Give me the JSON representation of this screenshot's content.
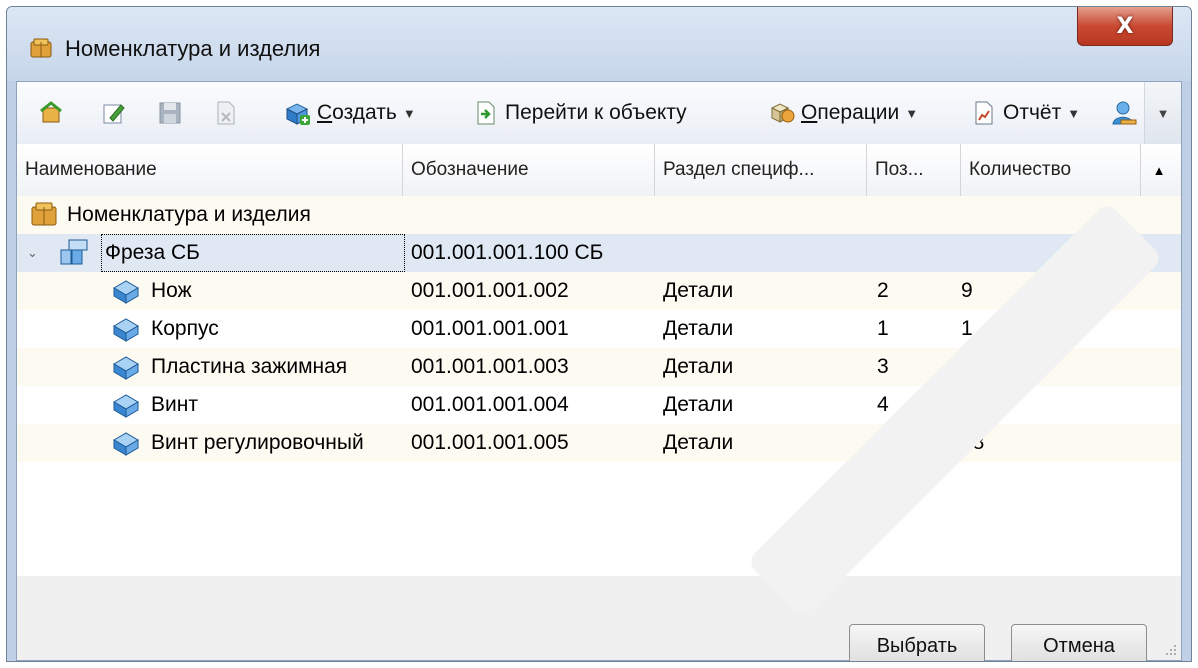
{
  "window": {
    "title": "Номенклатура и изделия",
    "close_label": "X"
  },
  "toolbar": {
    "create_accel": "С",
    "create_rest": "оздать",
    "goto_label": "Перейти к объекту",
    "ops_accel": "О",
    "ops_rest": "перации",
    "report_label": "Отчёт"
  },
  "grid": {
    "columns": [
      "Наименование",
      "Обозначение",
      "Раздел специф...",
      "Поз...",
      "Количество"
    ],
    "root": {
      "name": "Номенклатура и изделия"
    },
    "assembly": {
      "name": "Фреза СБ",
      "designation": "001.001.001.100 СБ"
    },
    "rows": [
      {
        "name": "Нож",
        "designation": "001.001.001.002",
        "section": "Детали",
        "pos": "2",
        "qty": "9"
      },
      {
        "name": "Корпус",
        "designation": "001.001.001.001",
        "section": "Детали",
        "pos": "1",
        "qty": "1"
      },
      {
        "name": "Пластина зажимная",
        "designation": "001.001.001.003",
        "section": "Детали",
        "pos": "3",
        "qty": "9"
      },
      {
        "name": "Винт",
        "designation": "001.001.001.004",
        "section": "Детали",
        "pos": "4",
        "qty": "27"
      },
      {
        "name": "Винт регулировочный",
        "designation": "001.001.001.005",
        "section": "Детали",
        "pos": "5",
        "qty": "18"
      }
    ]
  },
  "footer": {
    "select_label": "Выбрать",
    "cancel_label": "Отмена"
  },
  "colors": {
    "title_bar": "#c6d6ea",
    "close_button": "#c94a33",
    "selection": "#dfe8f3",
    "alt_row": "#fcfaf1"
  }
}
